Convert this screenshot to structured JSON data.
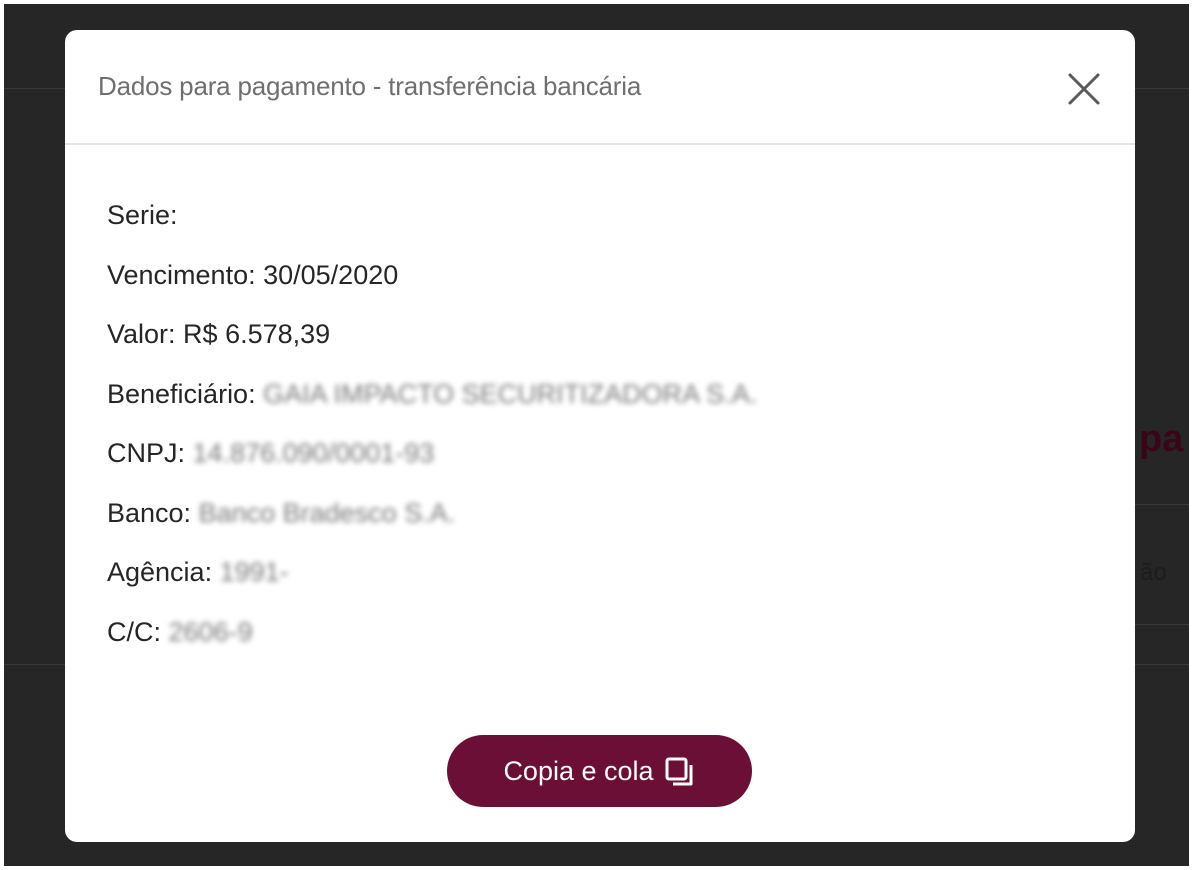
{
  "background": {
    "heading_fragment": "pa",
    "sub_fragment": "ão"
  },
  "modal": {
    "title": "Dados para pagamento - transferência bancária",
    "close_icon": "close-icon",
    "fields": [
      {
        "label": "Serie:",
        "value": "",
        "blurred": false
      },
      {
        "label": "Vencimento:",
        "value": "30/05/2020",
        "blurred": false
      },
      {
        "label": "Valor:",
        "value": "R$ 6.578,39",
        "blurred": false
      },
      {
        "label": "Beneficiário:",
        "value": "GAIA IMPACTO SECURITIZADORA S.A.",
        "blurred": true
      },
      {
        "label": "CNPJ:",
        "value": "14.876.090/0001-93",
        "blurred": true
      },
      {
        "label": "Banco:",
        "value": "Banco Bradesco S.A.",
        "blurred": true
      },
      {
        "label": "Agência:",
        "value": "1991-",
        "blurred": true
      },
      {
        "label": "C/C:",
        "value": "2606-9",
        "blurred": true
      }
    ],
    "copy_button": {
      "label": "Copia e cola",
      "icon": "copy-icon"
    }
  },
  "colors": {
    "accent": "#6b0f37",
    "backdrop": "#262626",
    "title_text": "#6f6f6f",
    "body_text": "#262626"
  }
}
